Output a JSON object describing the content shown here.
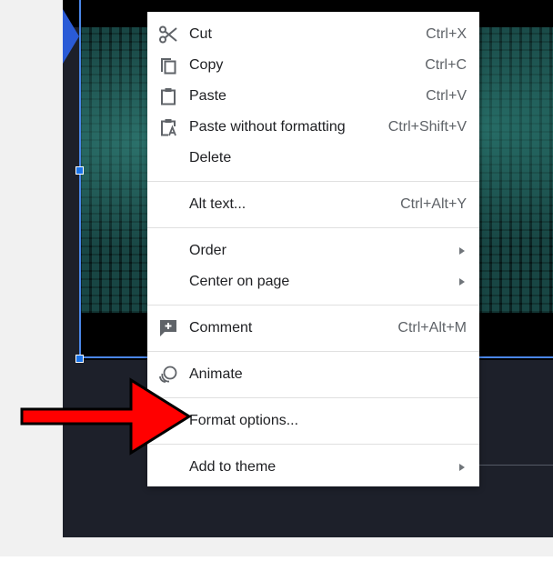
{
  "menu": {
    "items": [
      {
        "label": "Cut",
        "shortcut": "Ctrl+X",
        "icon": "scissors-icon"
      },
      {
        "label": "Copy",
        "shortcut": "Ctrl+C",
        "icon": "copy-icon"
      },
      {
        "label": "Paste",
        "shortcut": "Ctrl+V",
        "icon": "clipboard-icon"
      },
      {
        "label": "Paste without formatting",
        "shortcut": "Ctrl+Shift+V",
        "icon": "paste-plain-icon"
      },
      {
        "label": "Delete",
        "shortcut": ""
      },
      {
        "label": "Alt text...",
        "shortcut": "Ctrl+Alt+Y"
      },
      {
        "label": "Order",
        "shortcut": "",
        "submenu": true
      },
      {
        "label": "Center on page",
        "shortcut": "",
        "submenu": true
      },
      {
        "label": "Comment",
        "shortcut": "Ctrl+Alt+M",
        "icon": "add-comment-icon"
      },
      {
        "label": "Animate",
        "shortcut": "",
        "icon": "animate-icon"
      },
      {
        "label": "Format options...",
        "shortcut": ""
      },
      {
        "label": "Add to theme",
        "shortcut": "",
        "submenu": true
      }
    ]
  },
  "colors": {
    "selection": "#4a86e8",
    "handle": "#1a73e8",
    "arrow": "#ff0000",
    "slide_background": "#1d202a"
  }
}
